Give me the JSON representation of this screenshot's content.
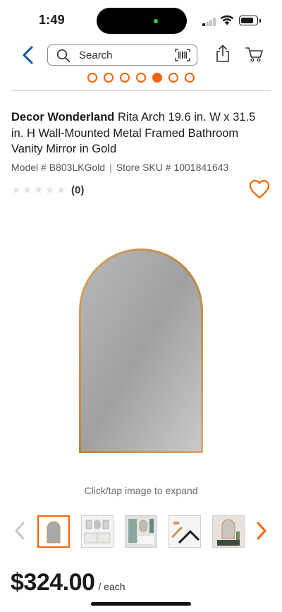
{
  "status_bar": {
    "time": "1:49"
  },
  "header": {
    "search_placeholder": "Search",
    "icons": [
      "back-chevron-icon",
      "search-icon",
      "barcode-scan-icon",
      "share-icon",
      "cart-icon"
    ]
  },
  "gallery_pager": {
    "count": 7,
    "active_index": 4
  },
  "product": {
    "brand": "Decor Wonderland",
    "title": "Rita Arch 19.6 in. W x 31.5 in. H Wall-Mounted Metal Framed Bathroom Vanity Mirror in Gold",
    "model_label": "Model # B803LKGold",
    "separator": "|",
    "sku_label": "Store SKU # 1001841643",
    "rating_stars": 0,
    "rating_count": "(0)",
    "expand_hint": "Click/tap image to expand",
    "price": "$324.00",
    "price_unit": "/ each"
  },
  "thumbnails": {
    "selected_index": 0,
    "items": [
      "arched-mirror-front",
      "vanity-room-scene",
      "bathroom-room-scene",
      "mirror-bracket-detail",
      "arched-mirror-room-scene"
    ]
  },
  "colors": {
    "brand_orange": "#f96302",
    "link_blue": "#1f5fa6",
    "mirror_gold": "#c9954f"
  }
}
